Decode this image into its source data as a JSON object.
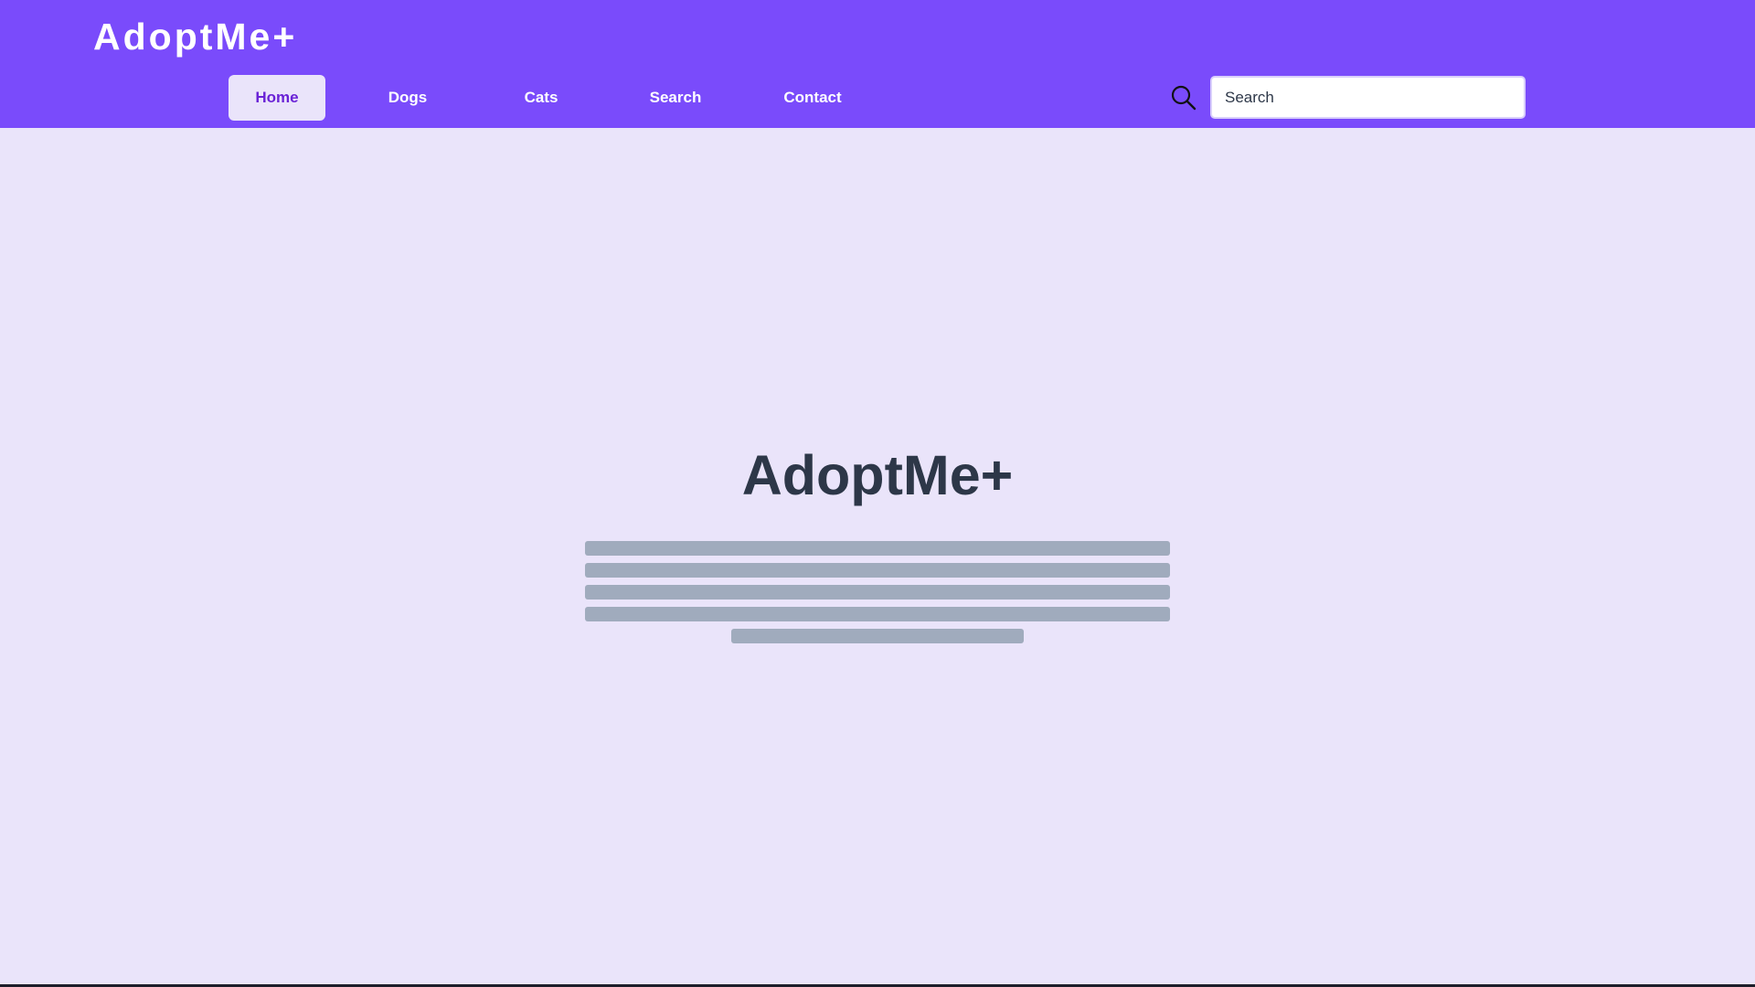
{
  "app": {
    "logo": "AdoptMe+"
  },
  "nav": {
    "items": [
      {
        "label": "Home",
        "active": true
      },
      {
        "label": "Dogs",
        "active": false
      },
      {
        "label": "Cats",
        "active": false
      },
      {
        "label": "Search",
        "active": false
      },
      {
        "label": "Contact",
        "active": false
      }
    ]
  },
  "search": {
    "icon": "search-icon",
    "placeholder": "Search",
    "value": ""
  },
  "hero": {
    "title": "AdoptMe+"
  },
  "colors": {
    "header_bg": "#7A4BFB",
    "page_bg": "#EAE4FA",
    "active_tab_text": "#6A22D6",
    "title_text": "#2D3748",
    "skeleton": "#A0ABBD"
  }
}
